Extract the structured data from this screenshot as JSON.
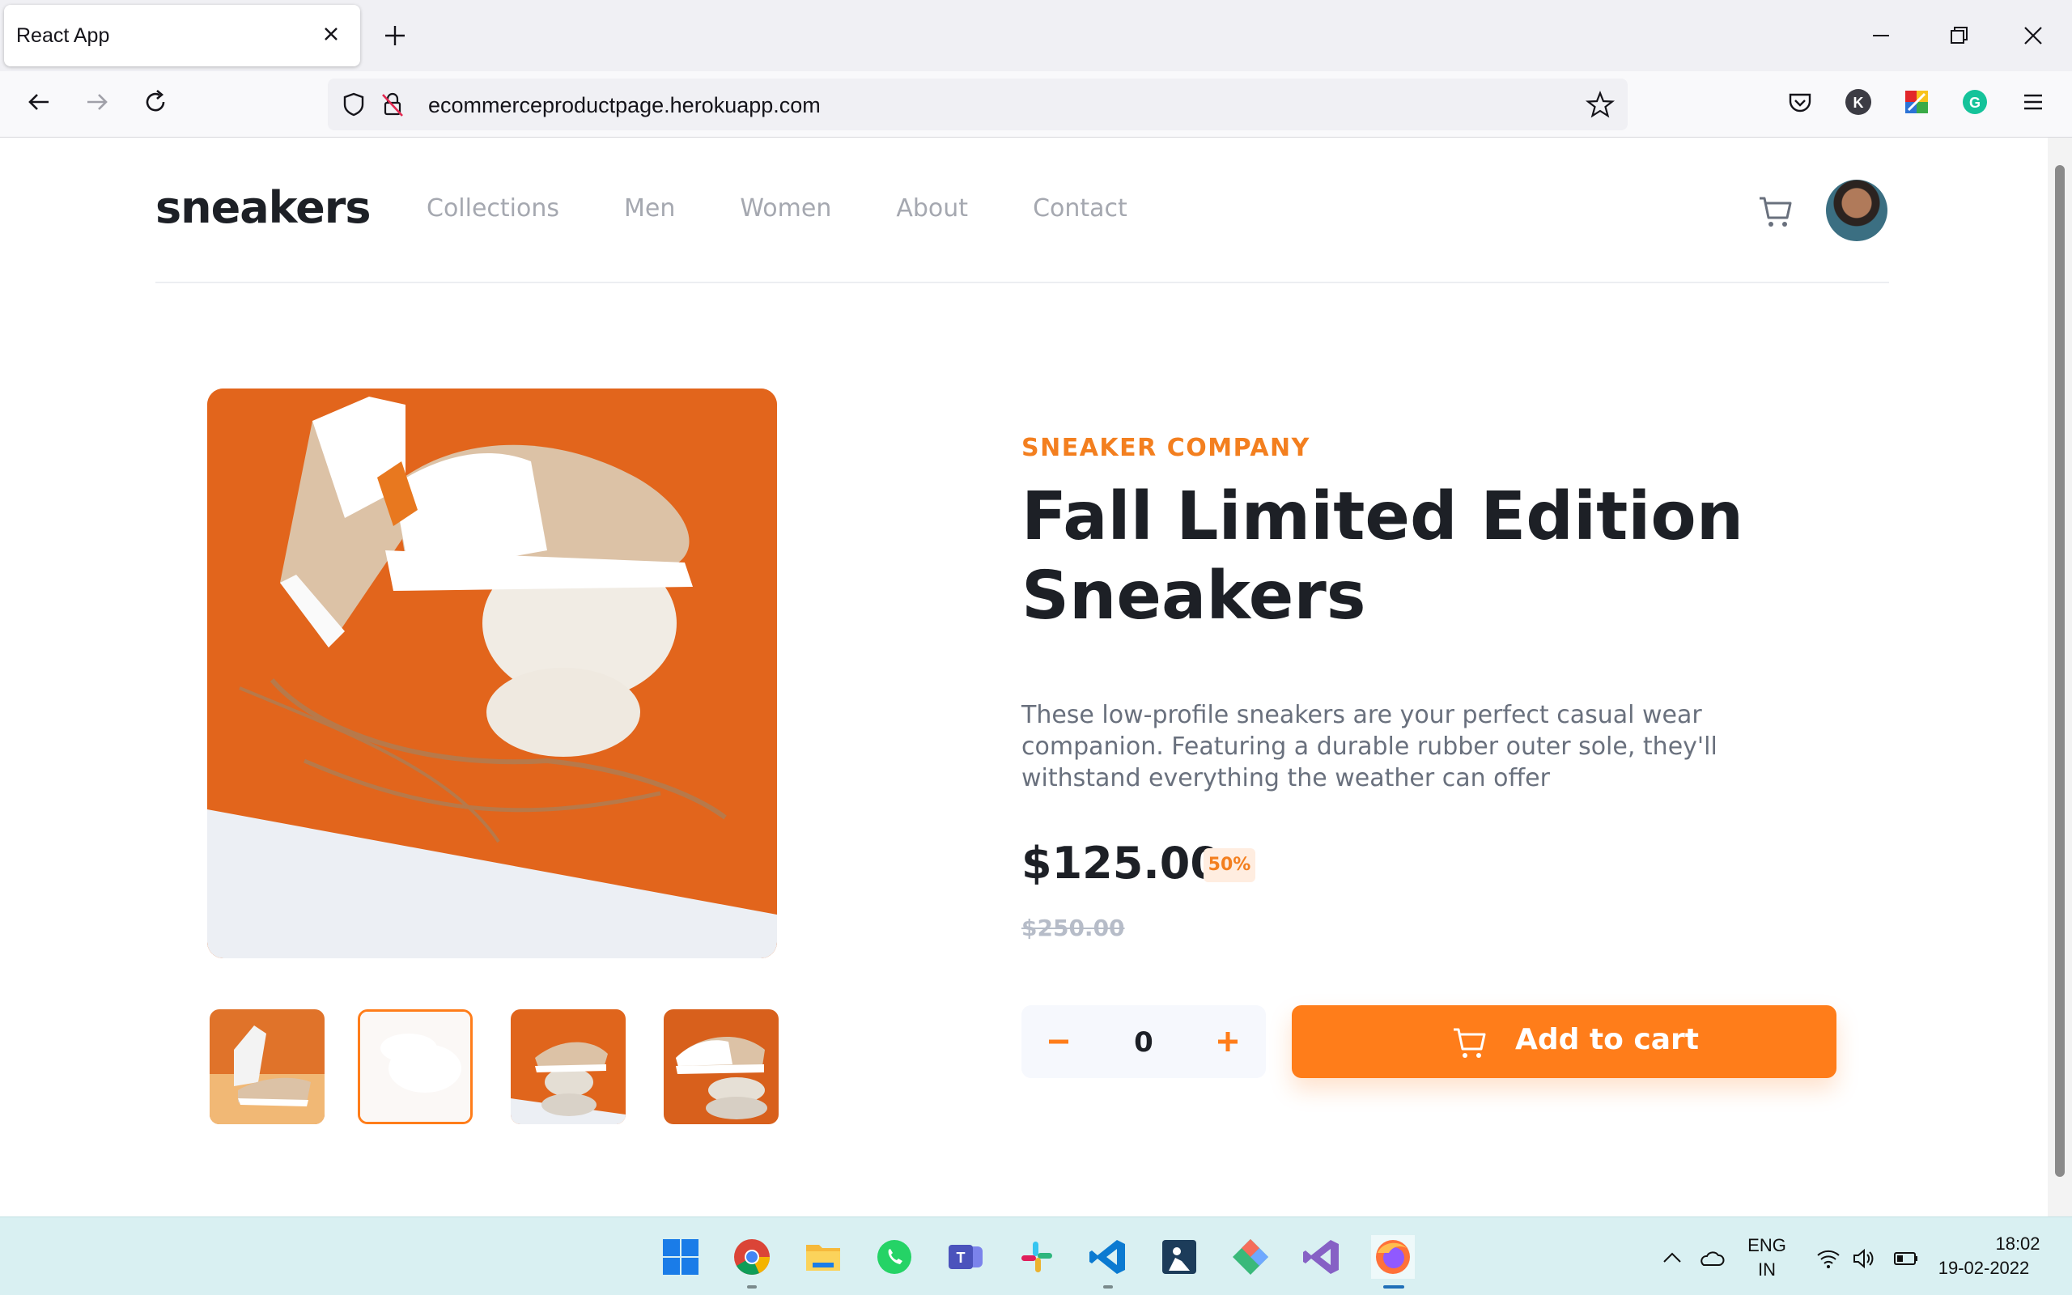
{
  "browser": {
    "tab_title": "React App",
    "url": "ecommerceproductpage.herokuapp.com"
  },
  "header": {
    "logo": "sneakers",
    "menu": [
      "Collections",
      "Men",
      "Women",
      "About",
      "Contact"
    ]
  },
  "product": {
    "company": "SNEAKER COMPANY",
    "title": "Fall Limited Edition Sneakers",
    "description": "These low-profile sneakers are your perfect casual wear companion. Featuring a durable rubber outer sole, they'll withstand everything the weather can offer",
    "price": "$125.00",
    "discount": "50%",
    "old_price": "$250.00",
    "quantity": "0",
    "add_to_cart": "Add to cart",
    "selected_thumbnail": 2
  },
  "colors": {
    "accent": "#ff7d1a",
    "accent_light": "#ffede0",
    "dark": "#1d2026",
    "text_muted": "#69707d"
  },
  "taskbar": {
    "lang_line1": "ENG",
    "lang_line2": "IN",
    "time": "18:02",
    "date": "19-02-2022",
    "apps": [
      "start-icon",
      "chrome-icon",
      "file-explorer-icon",
      "whatsapp-icon",
      "teams-icon",
      "slack-icon",
      "vscode-icon",
      "kindle-icon",
      "git-icon",
      "visual-studio-icon",
      "firefox-icon"
    ]
  }
}
